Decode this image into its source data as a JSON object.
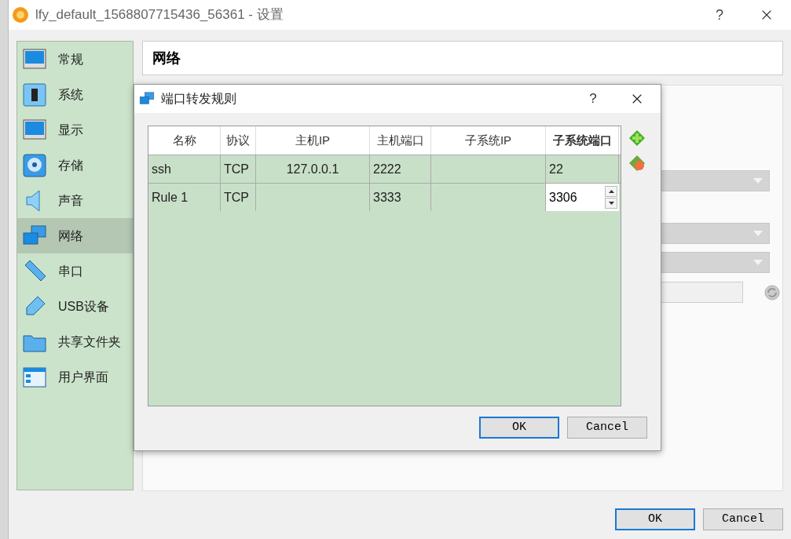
{
  "window": {
    "title": "lfy_default_1568807715436_56361 - 设置",
    "help": "?"
  },
  "sidebar": {
    "items": [
      {
        "label": "常规",
        "kind": "general",
        "selected": false
      },
      {
        "label": "系统",
        "kind": "system",
        "selected": false
      },
      {
        "label": "显示",
        "kind": "display",
        "selected": false
      },
      {
        "label": "存储",
        "kind": "storage",
        "selected": false
      },
      {
        "label": "声音",
        "kind": "audio",
        "selected": false
      },
      {
        "label": "网络",
        "kind": "network",
        "selected": true
      },
      {
        "label": "串口",
        "kind": "serial",
        "selected": false
      },
      {
        "label": "USB设备",
        "kind": "usb",
        "selected": false
      },
      {
        "label": "共享文件夹",
        "kind": "folder",
        "selected": false
      },
      {
        "label": "用户界面",
        "kind": "ui",
        "selected": false
      }
    ]
  },
  "section_title": "网络",
  "dialog": {
    "title": "端口转发规则",
    "help": "?",
    "table": {
      "columns": [
        {
          "label": "名称",
          "kind": "text",
          "selected": false
        },
        {
          "label": "协议",
          "kind": "text",
          "selected": false
        },
        {
          "label": "主机IP",
          "kind": "address",
          "selected": false
        },
        {
          "label": "主机端口",
          "kind": "text",
          "selected": false
        },
        {
          "label": "子系统IP",
          "kind": "address",
          "selected": false
        },
        {
          "label": "子系统端口",
          "kind": "text",
          "selected": true
        }
      ],
      "rows": [
        {
          "cells": [
            {
              "kind": "text",
              "text": "ssh"
            },
            {
              "kind": "text",
              "text": "TCP"
            },
            {
              "kind": "text",
              "text": "127.0.0.1"
            },
            {
              "kind": "text",
              "text": "2222"
            },
            {
              "kind": "empty"
            },
            {
              "kind": "text",
              "text": "22"
            }
          ]
        },
        {
          "cells": [
            {
              "kind": "text",
              "text": "Rule 1"
            },
            {
              "kind": "text",
              "text": "TCP"
            },
            {
              "kind": "empty"
            },
            {
              "kind": "text",
              "text": "3333"
            },
            {
              "kind": "empty"
            },
            {
              "kind": "spinbox",
              "text": "3306"
            }
          ]
        }
      ]
    },
    "buttons": [
      {
        "label": "OK",
        "default": true
      },
      {
        "label": "Cancel",
        "default": false
      }
    ]
  },
  "buttons": [
    {
      "label": "OK",
      "default": true
    },
    {
      "label": "Cancel",
      "default": false
    }
  ]
}
